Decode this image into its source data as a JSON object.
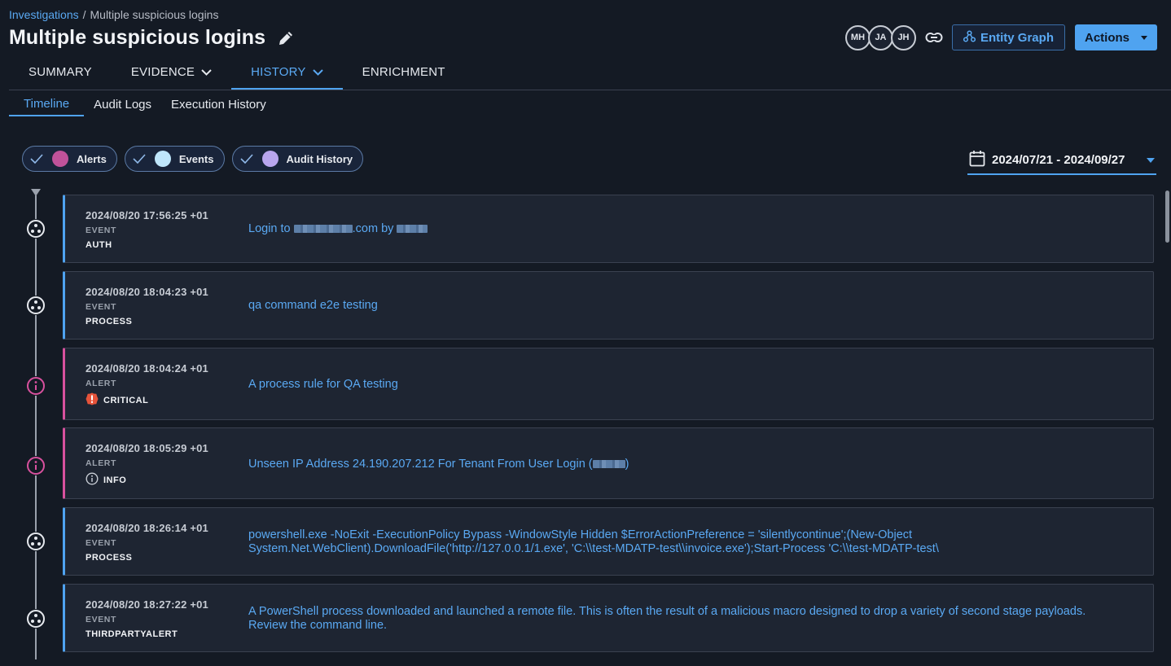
{
  "breadcrumb": {
    "root": "Investigations",
    "separator": "/",
    "current": "Multiple suspicious logins"
  },
  "page_title": "Multiple suspicious logins",
  "avatars": [
    "MH",
    "JA",
    "JH"
  ],
  "buttons": {
    "entity_graph": "Entity Graph",
    "actions": "Actions"
  },
  "tabs": [
    {
      "label": "SUMMARY"
    },
    {
      "label": "EVIDENCE"
    },
    {
      "label": "HISTORY"
    },
    {
      "label": "ENRICHMENT"
    }
  ],
  "subtabs": [
    "Timeline",
    "Audit Logs",
    "Execution History"
  ],
  "filters": [
    {
      "label": "Alerts",
      "color": "#c0529a"
    },
    {
      "label": "Events",
      "color": "#bfe6fb"
    },
    {
      "label": "Audit History",
      "color": "#b9a6ee"
    }
  ],
  "date_range": "2024/07/21 - 2024/09/27",
  "colors": {
    "accent": "#4fa3f0",
    "alert": "#d8519e",
    "critical": "#e6533a"
  },
  "timeline": [
    {
      "time": "2024/08/20 17:56:25 +01",
      "kind": "EVENT",
      "category": "AUTH",
      "desc_prefix": "Login to",
      "desc_mid": ".com by",
      "desc_suffix": ""
    },
    {
      "time": "2024/08/20 18:04:23 +01",
      "kind": "EVENT",
      "category": "PROCESS",
      "description": "qa command e2e testing"
    },
    {
      "time": "2024/08/20 18:04:24 +01",
      "kind": "ALERT",
      "category": "CRITICAL",
      "description": "A process rule for QA testing"
    },
    {
      "time": "2024/08/20 18:05:29 +01",
      "kind": "ALERT",
      "category": "INFO",
      "desc_prefix": "Unseen IP Address 24.190.207.212 For Tenant From User Login (",
      "desc_suffix": ")"
    },
    {
      "time": "2024/08/20 18:26:14 +01",
      "kind": "EVENT",
      "category": "PROCESS",
      "description": "powershell.exe -NoExit -ExecutionPolicy Bypass -WindowStyle Hidden $ErrorActionPreference = 'silentlycontinue';(New-Object System.Net.WebClient).DownloadFile('http://127.0.0.1/1.exe', 'C:\\\\test-MDATP-test\\\\invoice.exe');Start-Process 'C:\\\\test-MDATP-test\\"
    },
    {
      "time": "2024/08/20 18:27:22 +01",
      "kind": "EVENT",
      "category": "THIRDPARTYALERT",
      "description": "A PowerShell process downloaded and launched a remote file. This is often the result of a malicious macro designed to drop a variety of second stage payloads. Review the command line."
    }
  ]
}
